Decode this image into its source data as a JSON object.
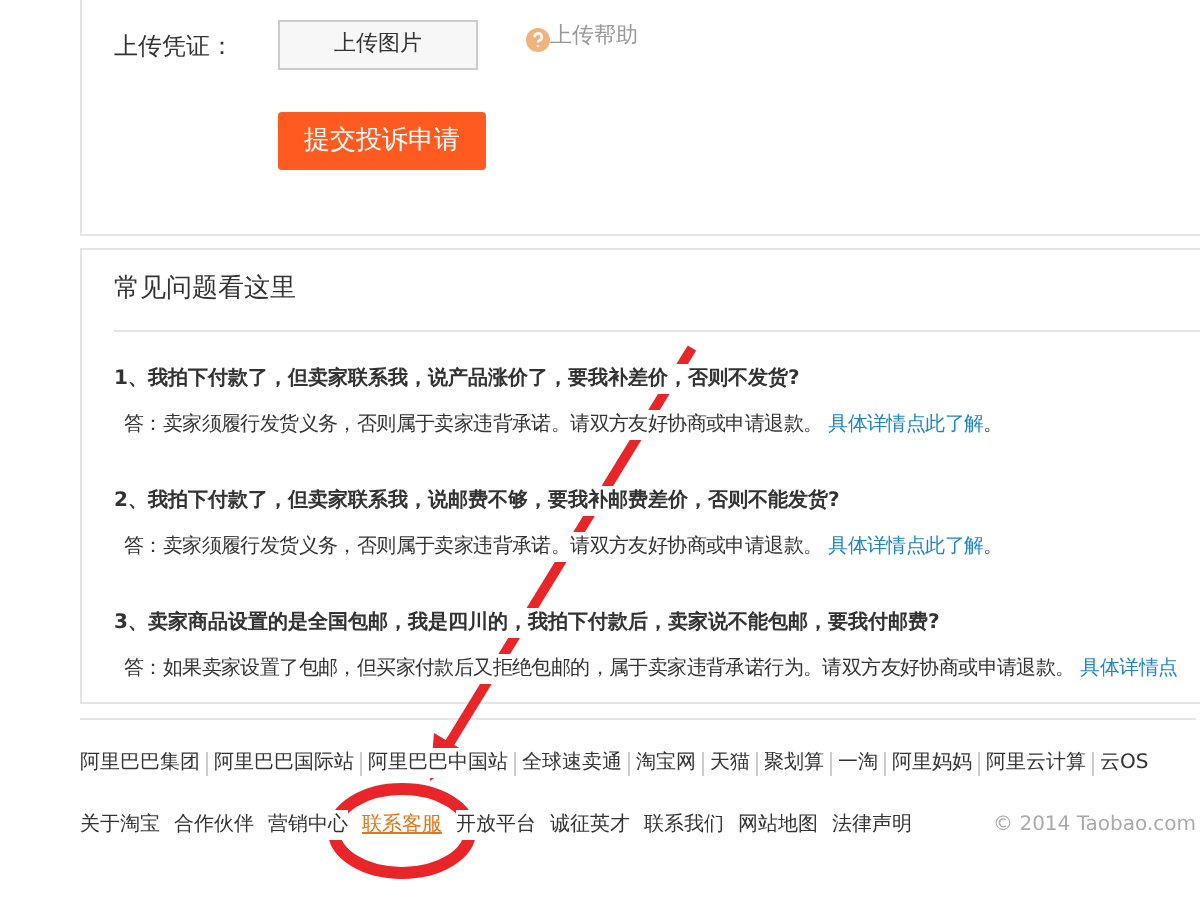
{
  "upload": {
    "label": "上传凭证：",
    "button": "上传图片",
    "help": "上传帮助"
  },
  "submit": "提交投诉申请",
  "faq": {
    "title": "常见问题看这里",
    "items": [
      {
        "question": "1、我拍下付款了，但卖家联系我，说产品涨价了，要我补差价，否则不发货?",
        "answer": "答：卖家须履行发货义务，否则属于卖家违背承诺。请双方友好协商或申请退款。",
        "link": "具体详情点此了解",
        "tail": "。"
      },
      {
        "question": "2、我拍下付款了，但卖家联系我，说邮费不够，要我补邮费差价，否则不能发货?",
        "answer": "答：卖家须履行发货义务，否则属于卖家违背承诺。请双方友好协商或申请退款。",
        "link": "具体详情点此了解",
        "tail": "。"
      },
      {
        "question": "3、卖家商品设置的是全国包邮，我是四川的，我拍下付款后，卖家说不能包邮，要我付邮费?",
        "answer": "答：如果卖家设置了包邮，但买家付款后又拒绝包邮的，属于卖家违背承诺行为。请双方友好协商或申请退款。",
        "link": "具体详情点"
      }
    ]
  },
  "footer": {
    "sites": [
      "阿里巴巴集团",
      "阿里巴巴国际站",
      "阿里巴巴中国站",
      "全球速卖通",
      "淘宝网",
      "天猫",
      "聚划算",
      "一淘",
      "阿里妈妈",
      "阿里云计算",
      "云OS"
    ],
    "links": [
      {
        "label": "关于淘宝",
        "selected": false
      },
      {
        "label": "合作伙伴",
        "selected": false
      },
      {
        "label": "营销中心",
        "selected": false
      },
      {
        "label": "联系客服",
        "selected": true
      },
      {
        "label": "开放平台",
        "selected": false
      },
      {
        "label": "诚征英才",
        "selected": false
      },
      {
        "label": "联系我们",
        "selected": false
      },
      {
        "label": "网站地图",
        "selected": false
      },
      {
        "label": "法律声明",
        "selected": false
      }
    ],
    "copyright": "© 2014 Taobao.com"
  }
}
